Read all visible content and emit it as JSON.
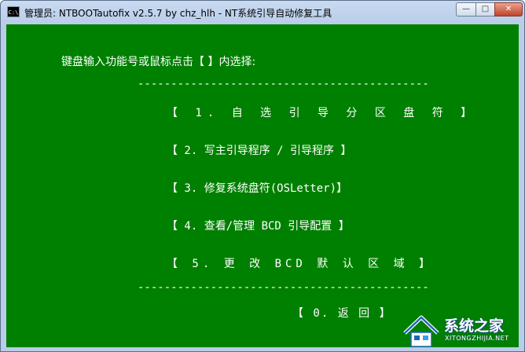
{
  "window": {
    "icon_text": "C:\\",
    "title": "管理员:  NTBOOTautofix v2.5.7 by chz_hlh - NT系统引导自动修复工具",
    "controls": {
      "minimize": "—",
      "maximize": "□",
      "close": "✕"
    }
  },
  "console": {
    "background": "#008000",
    "text_color": "#ffffff",
    "prompt": "键盘输入功能号或鼠标点击【  】内选择:",
    "separator": "--------------------------------------------",
    "menu": [
      {
        "label": "【 1. 自 选 引 导 分 区 盘 符 】"
      },
      {
        "label": "【 2. 写主引导程序 / 引导程序  】"
      },
      {
        "label": "【 3. 修复系统盘符(OSLetter)】"
      },
      {
        "label": "【 4. 查看/管理 BCD 引导配置   】"
      },
      {
        "label": "【 5. 更 改 BCD 默 认 区 域   】"
      }
    ],
    "back": "【 0. 返 回 】"
  },
  "watermark": {
    "text": "系统之家",
    "subtext": "XITONGZHIJIA.NET",
    "icon": "house-logo-icon"
  }
}
